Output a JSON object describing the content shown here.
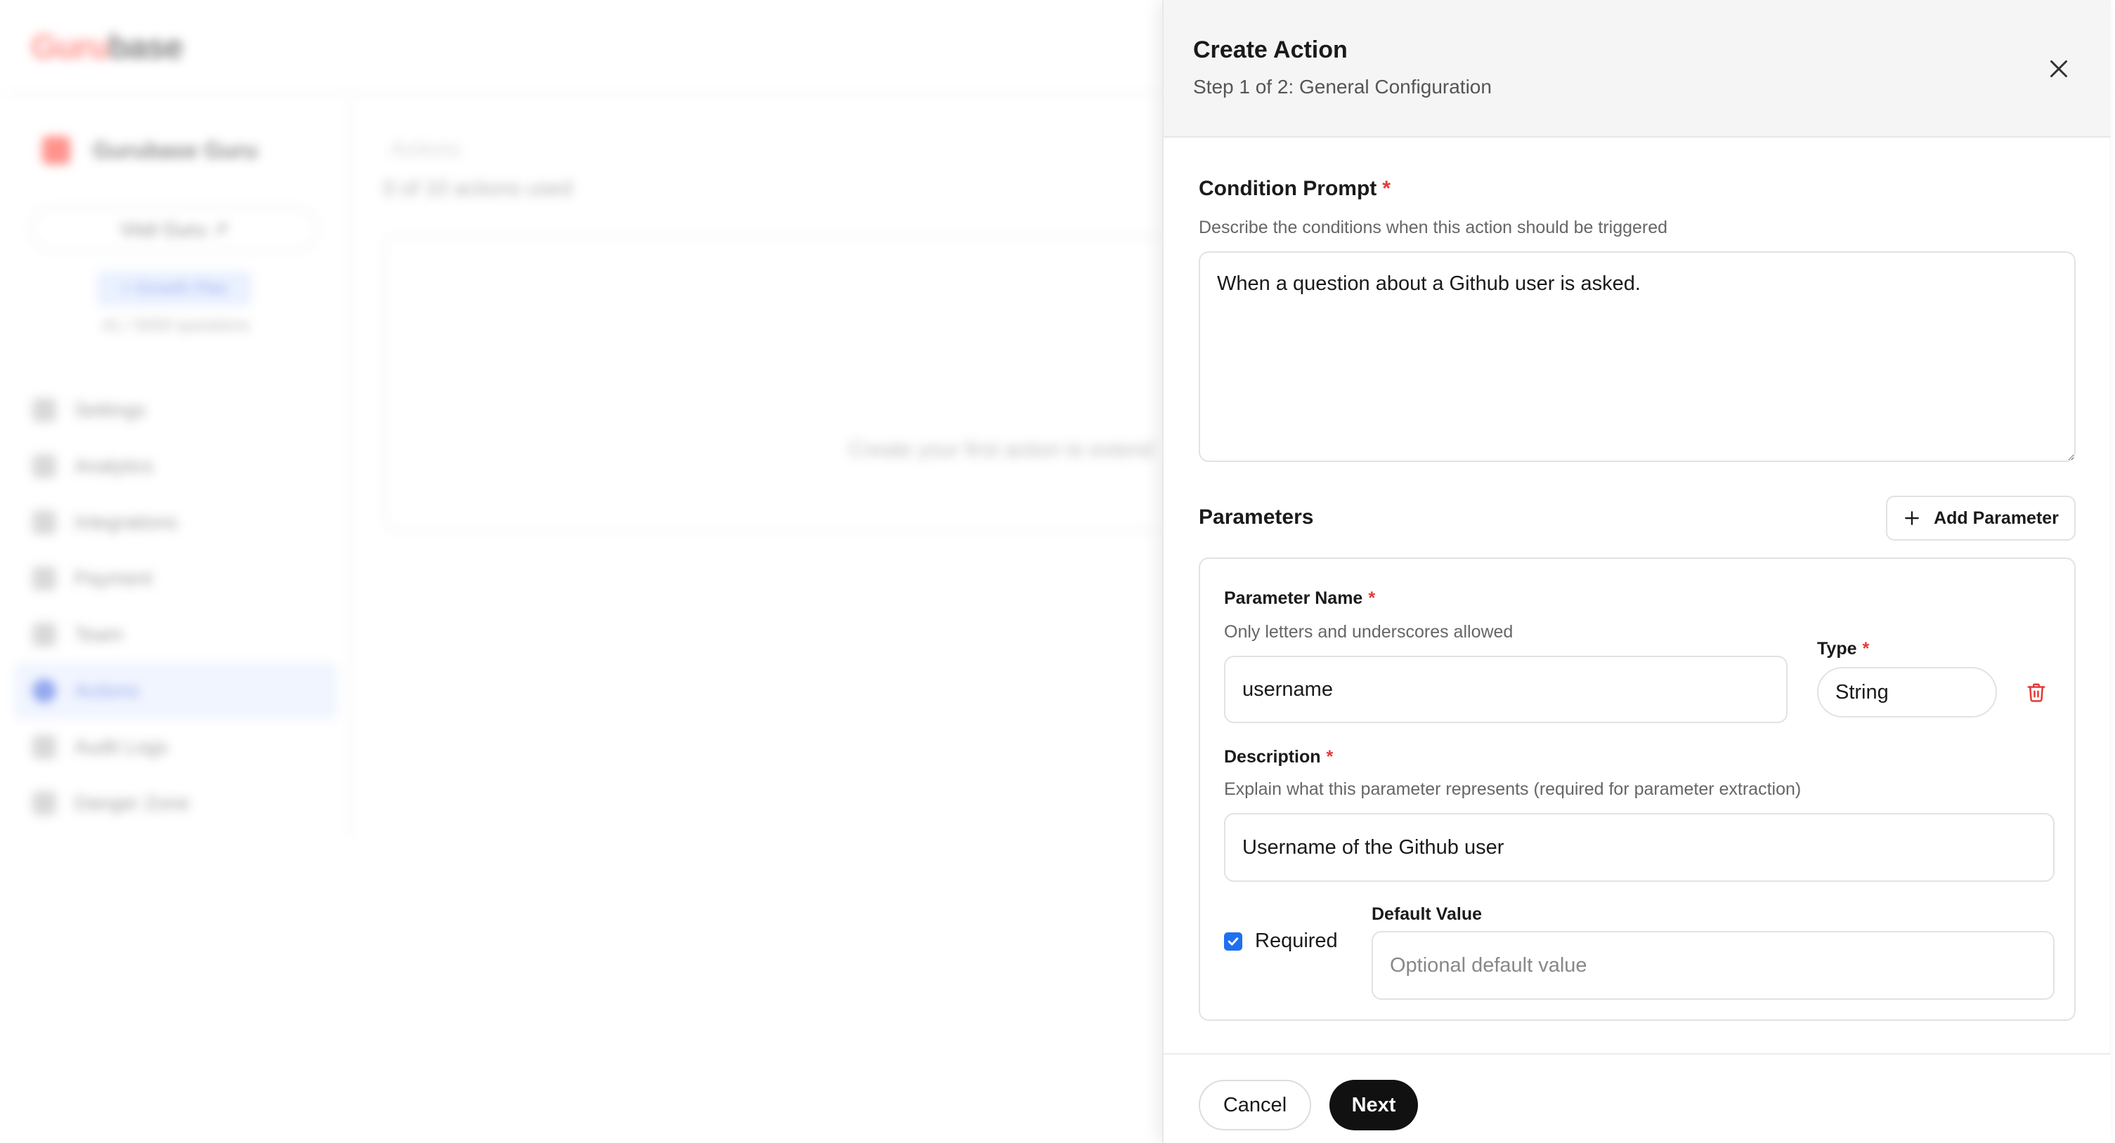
{
  "background": {
    "logo_part1": "Guru",
    "logo_part2": "base",
    "guru_name": "Gurubase Guru",
    "visit_label": "Visit Guru ↗",
    "plan_badge": "+ Growth Plan",
    "questions": "41 / 5000 questions",
    "nav": [
      {
        "label": "Settings"
      },
      {
        "label": "Analytics"
      },
      {
        "label": "Integrations"
      },
      {
        "label": "Payment"
      },
      {
        "label": "Team"
      },
      {
        "label": "Actions"
      },
      {
        "label": "Audit Logs"
      },
      {
        "label": "Danger Zone"
      }
    ],
    "main_title": "Actions",
    "main_subtitle": "0 of 10 actions used",
    "empty_state": "Create your first action to extend"
  },
  "panel": {
    "title": "Create Action",
    "subtitle": "Step 1 of 2: General Configuration",
    "close_icon": "close-icon"
  },
  "condition": {
    "label": "Condition Prompt",
    "required_mark": "*",
    "hint": "Describe the conditions when this action should be triggered",
    "value": "When a question about a Github user is asked."
  },
  "parameters": {
    "label": "Parameters",
    "add_button_label": "Add Parameter",
    "items": [
      {
        "name_label": "Parameter Name",
        "name_hint": "Only letters and underscores allowed",
        "name_value": "username",
        "type_label": "Type",
        "type_value": "String",
        "description_label": "Description",
        "description_hint": "Explain what this parameter represents (required for parameter extraction)",
        "description_value": "Username of the Github user",
        "required_label": "Required",
        "required_checked": true,
        "default_label": "Default Value",
        "default_placeholder": "Optional default value",
        "default_value": ""
      }
    ]
  },
  "footer": {
    "cancel_label": "Cancel",
    "next_label": "Next"
  },
  "colors": {
    "required_star": "#e53935",
    "delete_icon": "#e53935",
    "checkbox": "#1e6ff2",
    "primary_button": "#111111"
  }
}
